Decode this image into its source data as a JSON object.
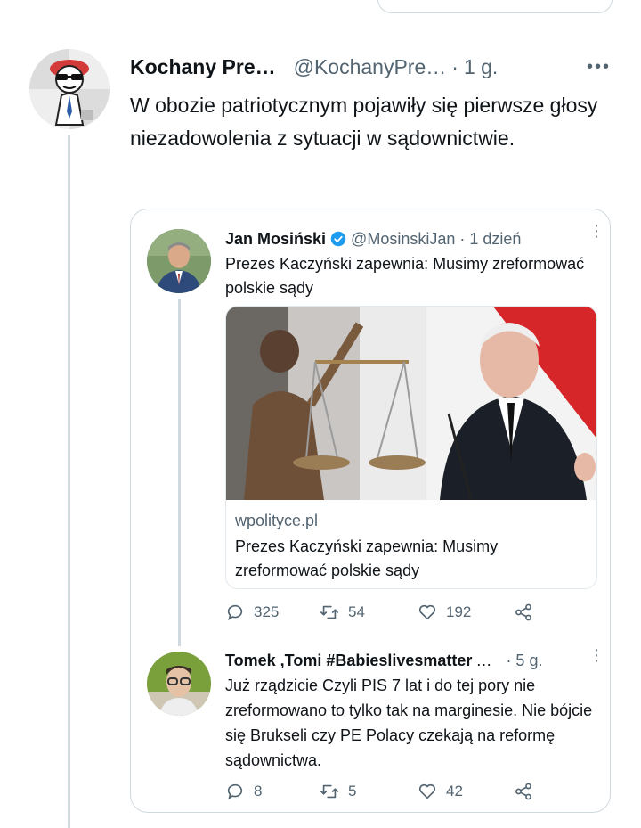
{
  "main_tweet": {
    "display_name": "Kochany Pre…",
    "handle": "@KochanyPre…",
    "separator": "·",
    "time": "1 g.",
    "more": "•••",
    "text": "W obozie patriotycznym pojawiły się pierwsze głosy niezadowolenia z sytuacji w sądownictwie."
  },
  "quoted_tweet": {
    "display_name": "Jan Mosiński",
    "handle": "@MosinskiJan",
    "time": "· 1 dzień",
    "more": "⋮",
    "text": "Prezes Kaczyński zapewnia: Musimy zreformować polskie sądy",
    "link_card": {
      "domain": "wpolityce.pl",
      "title": "Prezes Kaczyński zapewnia: Musimy zreformować polskie sądy"
    },
    "actions": {
      "replies": "325",
      "retweets": "54",
      "likes": "192"
    }
  },
  "reply_tweet": {
    "display_name": "Tomek ,Tomi #Babieslivesmatter",
    "ellipsis": "…",
    "time": "· 5 g.",
    "more": "⋮",
    "text": "Już rządzicie Czyli PIS 7 lat i do tej pory nie zreformowano to tylko tak na marginesie. Nie bójcie się Brukseli czy PE Polacy czekają na reformę sądownictwa.",
    "actions": {
      "replies": "8",
      "retweets": "5",
      "likes": "42"
    }
  },
  "colors": {
    "text_primary": "#0f1419",
    "text_secondary": "#536471",
    "border": "#cfd9de",
    "verified": "#1d9bf0"
  }
}
